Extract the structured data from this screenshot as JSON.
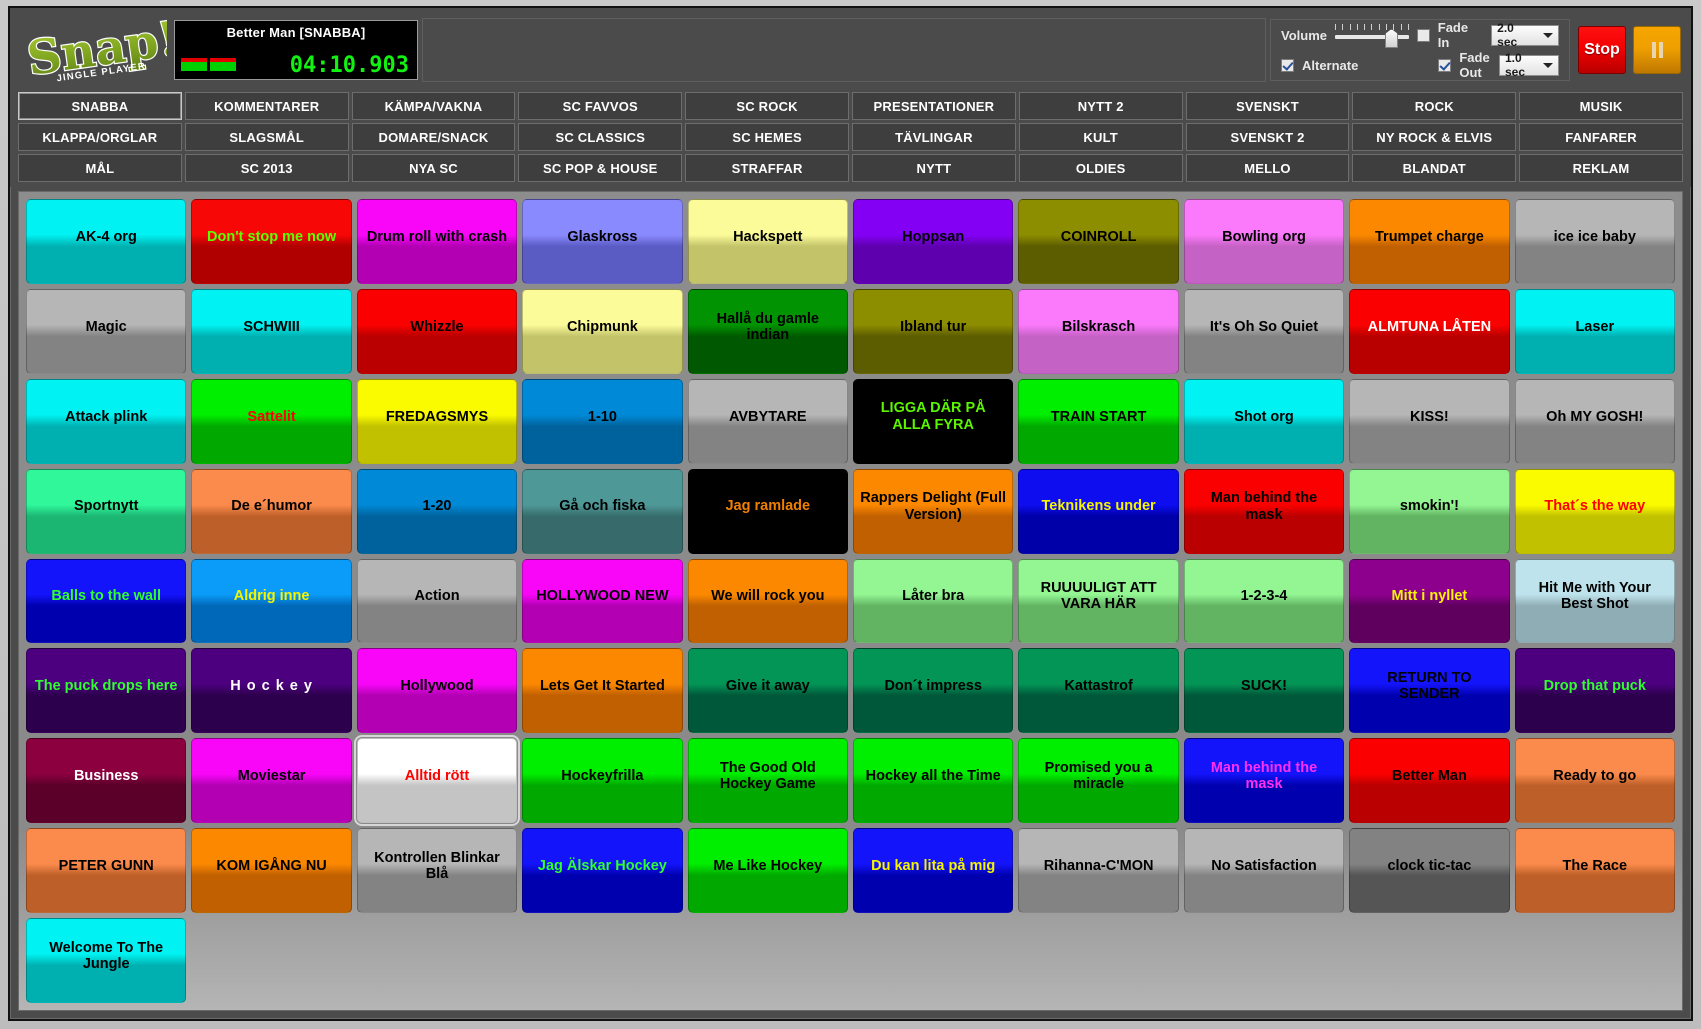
{
  "app": {
    "logo_text": "Snap!",
    "logo_subtitle": "JINGLE PLAYER"
  },
  "player": {
    "now_playing": "Better Man [SNABBA]",
    "time": "04:10.903"
  },
  "controls": {
    "volume_label": "Volume",
    "alternate_label": "Alternate",
    "alternate_checked": true,
    "fade_in_label": "Fade In",
    "fade_in_checked": false,
    "fade_in_value": "2.0 sec",
    "fade_out_label": "Fade Out",
    "fade_out_checked": true,
    "fade_out_value": "1.0 sec",
    "stop_label": "Stop",
    "pause_label": "Pause"
  },
  "tabs": {
    "active": "SNABBA",
    "rows": [
      [
        "SNABBA",
        "KOMMENTARER",
        "KÄMPA/VAKNA",
        "SC FAVVOS",
        "SC ROCK",
        "PRESENTATIONER",
        "NYTT 2",
        "SVENSKT",
        "ROCK",
        "MUSIK"
      ],
      [
        "KLAPPA/ORGLAR",
        "SLAGSMÅL",
        "DOMARE/SNACK",
        "SC CLASSICS",
        "SC HEMES",
        "TÄVLINGAR",
        "KULT",
        "SVENSKT 2",
        "NY ROCK & ELVIS",
        "FANFARER"
      ],
      [
        "MÅL",
        "SC 2013",
        "NYA SC",
        "SC POP & HOUSE",
        "STRAFFAR",
        "NYTT",
        "OLDIES",
        "MELLO",
        "BLANDAT",
        "REKLAM"
      ]
    ]
  },
  "grid": {
    "columns": 10,
    "rows": 9,
    "cells": [
      {
        "label": "AK-4 org",
        "top": "#00f2f2",
        "bottom": "#00b0b0",
        "fg": "#000000"
      },
      {
        "label": "Don't stop me now",
        "top": "#f80707",
        "bottom": "#b00000",
        "fg": "#5cff00"
      },
      {
        "label": "Drum roll with crash",
        "top": "#f906f9",
        "bottom": "#b200b2",
        "fg": "#000000"
      },
      {
        "label": "Glaskross",
        "top": "#8a8aff",
        "bottom": "#5b5bc4",
        "fg": "#000000"
      },
      {
        "label": "Hackspett",
        "top": "#fbfb9a",
        "bottom": "#c3c36a",
        "fg": "#000000"
      },
      {
        "label": "Hoppsan",
        "top": "#8400f5",
        "bottom": "#5e00ae",
        "fg": "#000000"
      },
      {
        "label": "COINROLL",
        "top": "#8d8d00",
        "bottom": "#5c5c00",
        "fg": "#000000"
      },
      {
        "label": "Bowling org",
        "top": "#fb79fb",
        "bottom": "#c562c5",
        "fg": "#000000"
      },
      {
        "label": "Trumpet charge",
        "top": "#fc8800",
        "bottom": "#c06000",
        "fg": "#000000"
      },
      {
        "label": "ice ice baby",
        "top": "#b6b6b6",
        "bottom": "#838383",
        "fg": "#000000"
      },
      {
        "label": "Magic",
        "top": "#b6b6b6",
        "bottom": "#838383",
        "fg": "#000000"
      },
      {
        "label": "SCHWIII",
        "top": "#00f2f2",
        "bottom": "#00b0b0",
        "fg": "#000000"
      },
      {
        "label": "Whizzle",
        "top": "#fb0000",
        "bottom": "#ba0000",
        "fg": "#000000"
      },
      {
        "label": "Chipmunk",
        "top": "#fbfb9a",
        "bottom": "#c3c36a",
        "fg": "#000000"
      },
      {
        "label": "Hallå du gamle indian",
        "top": "#019301",
        "bottom": "#005900",
        "fg": "#000000"
      },
      {
        "label": "Ibland tur",
        "top": "#8d8d00",
        "bottom": "#5c5c00",
        "fg": "#000000"
      },
      {
        "label": "Bilskrasch",
        "top": "#fb79fb",
        "bottom": "#c562c5",
        "fg": "#000000"
      },
      {
        "label": "It's Oh So Quiet",
        "top": "#b6b6b6",
        "bottom": "#838383",
        "fg": "#000000"
      },
      {
        "label": "ALMTUNA LÅTEN",
        "top": "#fb0000",
        "bottom": "#b80000",
        "fg": "#ffffff"
      },
      {
        "label": "Laser",
        "top": "#00f2f2",
        "bottom": "#00b0b0",
        "fg": "#000000"
      },
      {
        "label": "Attack plink",
        "top": "#00f2f2",
        "bottom": "#00b0b0",
        "fg": "#000000"
      },
      {
        "label": "Sattelit",
        "top": "#00ee00",
        "bottom": "#00a800",
        "fg": "#ff0000"
      },
      {
        "label": "FREDAGSMYS",
        "top": "#fbfb00",
        "bottom": "#c1c100",
        "fg": "#000000"
      },
      {
        "label": "1-10",
        "top": "#0089d6",
        "bottom": "#00629c",
        "fg": "#000000"
      },
      {
        "label": "AVBYTARE",
        "top": "#b6b6b6",
        "bottom": "#838383",
        "fg": "#000000"
      },
      {
        "label": "LIGGA DÄR PÅ ALLA FYRA",
        "top": "#000000",
        "bottom": "#000000",
        "fg": "#5cf500"
      },
      {
        "label": "TRAIN START",
        "top": "#00ee00",
        "bottom": "#00a800",
        "fg": "#000000"
      },
      {
        "label": "Shot org",
        "top": "#00f2f2",
        "bottom": "#00b0b0",
        "fg": "#000000"
      },
      {
        "label": "KISS!",
        "top": "#b6b6b6",
        "bottom": "#838383",
        "fg": "#000000"
      },
      {
        "label": "Oh MY GOSH!",
        "top": "#b6b6b6",
        "bottom": "#838383",
        "fg": "#000000"
      },
      {
        "label": "Sportnytt",
        "top": "#2ff79a",
        "bottom": "#1cb673",
        "fg": "#000000"
      },
      {
        "label": "De e´humor",
        "top": "#fb8b4c",
        "bottom": "#bd5f28",
        "fg": "#000000"
      },
      {
        "label": "1-20",
        "top": "#0089d6",
        "bottom": "#00629c",
        "fg": "#000000"
      },
      {
        "label": "Gå och fiska",
        "top": "#4f9898",
        "bottom": "#376b6b",
        "fg": "#000000"
      },
      {
        "label": "Jag ramlade",
        "top": "#000000",
        "bottom": "#000000",
        "fg": "#f08000"
      },
      {
        "label": "Rappers Delight (Full Version)",
        "top": "#fc8800",
        "bottom": "#c06000",
        "fg": "#000000"
      },
      {
        "label": "Teknikens under",
        "top": "#0d0df0",
        "bottom": "#0000a8",
        "fg": "#f5f500"
      },
      {
        "label": "Man behind the mask",
        "top": "#fb0000",
        "bottom": "#ba0000",
        "fg": "#000000"
      },
      {
        "label": "smokin'!",
        "top": "#93f693",
        "bottom": "#62b362",
        "fg": "#000000"
      },
      {
        "label": "That´s the way",
        "top": "#fbfb00",
        "bottom": "#c1c100",
        "fg": "#ff0000"
      },
      {
        "label": "Balls to the wall",
        "top": "#1414fb",
        "bottom": "#0000ae",
        "fg": "#2fff2f"
      },
      {
        "label": "Aldrig inne",
        "top": "#0b9bf8",
        "bottom": "#0068b8",
        "fg": "#f5f500"
      },
      {
        "label": "Action",
        "top": "#b6b6b6",
        "bottom": "#838383",
        "fg": "#000000"
      },
      {
        "label": "HOLLYWOOD NEW",
        "top": "#f906f9",
        "bottom": "#b200b2",
        "fg": "#000000"
      },
      {
        "label": "We will rock you",
        "top": "#fc8800",
        "bottom": "#c06000",
        "fg": "#000000"
      },
      {
        "label": "Låter bra",
        "top": "#93f693",
        "bottom": "#62b362",
        "fg": "#000000"
      },
      {
        "label": "RUUUULIGT ATT VARA HÄR",
        "top": "#93f693",
        "bottom": "#62b362",
        "fg": "#000000"
      },
      {
        "label": "1-2-3-4",
        "top": "#93f693",
        "bottom": "#62b362",
        "fg": "#000000"
      },
      {
        "label": "Mitt i nyllet",
        "top": "#8d008d",
        "bottom": "#5f005f",
        "fg": "#f5f500"
      },
      {
        "label": "Hit Me with Your Best Shot",
        "top": "#bfe3ec",
        "bottom": "#8fadb5",
        "fg": "#000000"
      },
      {
        "label": "The puck drops here",
        "top": "#4c0080",
        "bottom": "#2c004c",
        "fg": "#2fff2f"
      },
      {
        "label": "H o c k e y",
        "top": "#4c0080",
        "bottom": "#2c004c",
        "fg": "#ffffff"
      },
      {
        "label": "Hollywood",
        "top": "#f906f9",
        "bottom": "#b200b2",
        "fg": "#000000"
      },
      {
        "label": "Lets Get It Started",
        "top": "#fc8800",
        "bottom": "#c06000",
        "fg": "#000000"
      },
      {
        "label": "Give it away",
        "top": "#029556",
        "bottom": "#00583a",
        "fg": "#000000"
      },
      {
        "label": "Don´t impress",
        "top": "#029556",
        "bottom": "#00583a",
        "fg": "#000000"
      },
      {
        "label": "Kattastrof",
        "top": "#029556",
        "bottom": "#00583a",
        "fg": "#000000"
      },
      {
        "label": "SUCK!",
        "top": "#029556",
        "bottom": "#00583a",
        "fg": "#000000"
      },
      {
        "label": "RETURN TO SENDER",
        "top": "#1414fb",
        "bottom": "#0000ae",
        "fg": "#000000"
      },
      {
        "label": "Drop that puck",
        "top": "#4c0080",
        "bottom": "#2c004c",
        "fg": "#2fff2f"
      },
      {
        "label": "Business",
        "top": "#8d0040",
        "bottom": "#5a0029",
        "fg": "#ffffff"
      },
      {
        "label": "Moviestar",
        "top": "#f906f9",
        "bottom": "#b200b2",
        "fg": "#000000"
      },
      {
        "label": "Alltid rött",
        "top": "#ffffff",
        "bottom": "#c4c4c4",
        "fg": "#ff0000",
        "selected": true
      },
      {
        "label": "Hockeyfrilla",
        "top": "#00ee00",
        "bottom": "#00a800",
        "fg": "#000000"
      },
      {
        "label": "The Good Old Hockey Game",
        "top": "#00ee00",
        "bottom": "#00a800",
        "fg": "#000000"
      },
      {
        "label": "Hockey all the Time",
        "top": "#00ee00",
        "bottom": "#00a800",
        "fg": "#000000"
      },
      {
        "label": "Promised you a miracle",
        "top": "#00ee00",
        "bottom": "#00a800",
        "fg": "#000000"
      },
      {
        "label": "Man behind the mask",
        "top": "#1414fb",
        "bottom": "#0000ae",
        "fg": "#ff2ff2"
      },
      {
        "label": "Better Man",
        "top": "#fb0000",
        "bottom": "#ba0000",
        "fg": "#000000"
      },
      {
        "label": "Ready to  go",
        "top": "#fb8b4c",
        "bottom": "#bd5f28",
        "fg": "#000000"
      },
      {
        "label": "PETER GUNN",
        "top": "#fb8b4c",
        "bottom": "#bd5f28",
        "fg": "#000000"
      },
      {
        "label": "KOM IGÅNG NU",
        "top": "#fc8800",
        "bottom": "#c06000",
        "fg": "#000000"
      },
      {
        "label": "Kontrollen Blinkar Blå",
        "top": "#b6b6b6",
        "bottom": "#838383",
        "fg": "#000000"
      },
      {
        "label": "Jag Älskar Hockey",
        "top": "#1414fb",
        "bottom": "#0000ae",
        "fg": "#2fff2f"
      },
      {
        "label": "Me Like Hockey",
        "top": "#00ee00",
        "bottom": "#00a800",
        "fg": "#000000"
      },
      {
        "label": "Du kan lita på mig",
        "top": "#1414fb",
        "bottom": "#0000ae",
        "fg": "#f5f500"
      },
      {
        "label": "Rihanna-C'MON",
        "top": "#b6b6b6",
        "bottom": "#838383",
        "fg": "#000000"
      },
      {
        "label": "No Satisfaction",
        "top": "#b6b6b6",
        "bottom": "#838383",
        "fg": "#000000"
      },
      {
        "label": "clock tic-tac",
        "top": "#828282",
        "bottom": "#555555",
        "fg": "#000000"
      },
      {
        "label": "The Race",
        "top": "#fb8b4c",
        "bottom": "#bd5f28",
        "fg": "#000000"
      },
      {
        "label": "Welcome To The Jungle",
        "top": "#00f2f2",
        "bottom": "#00b0b0",
        "fg": "#000000"
      }
    ]
  }
}
